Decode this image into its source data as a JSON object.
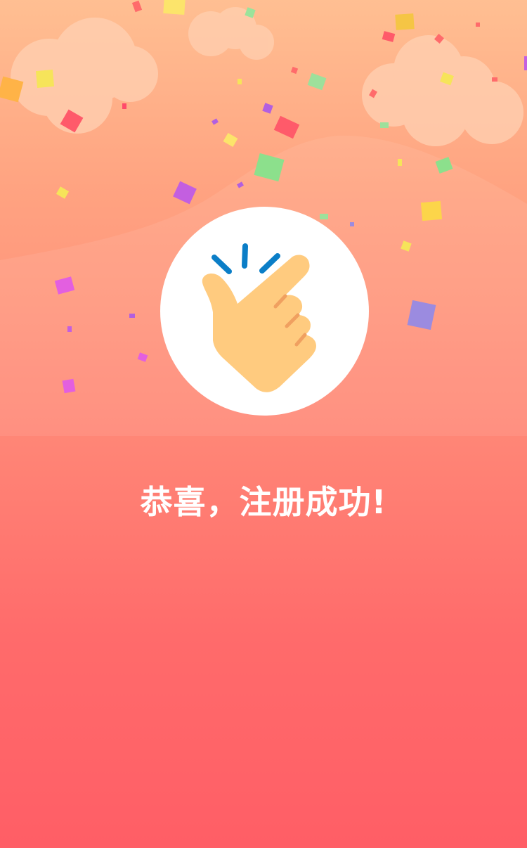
{
  "success_page": {
    "message": "恭喜，注册成功!",
    "icon": "finger-snap-icon"
  },
  "colors": {
    "background_top": "#ffbf92",
    "background_bottom": "#ff5e66",
    "badge": "#ffffff",
    "hand": "#ffcb7f",
    "snap_lines": "#0b7ec7",
    "text": "#ffffff"
  }
}
